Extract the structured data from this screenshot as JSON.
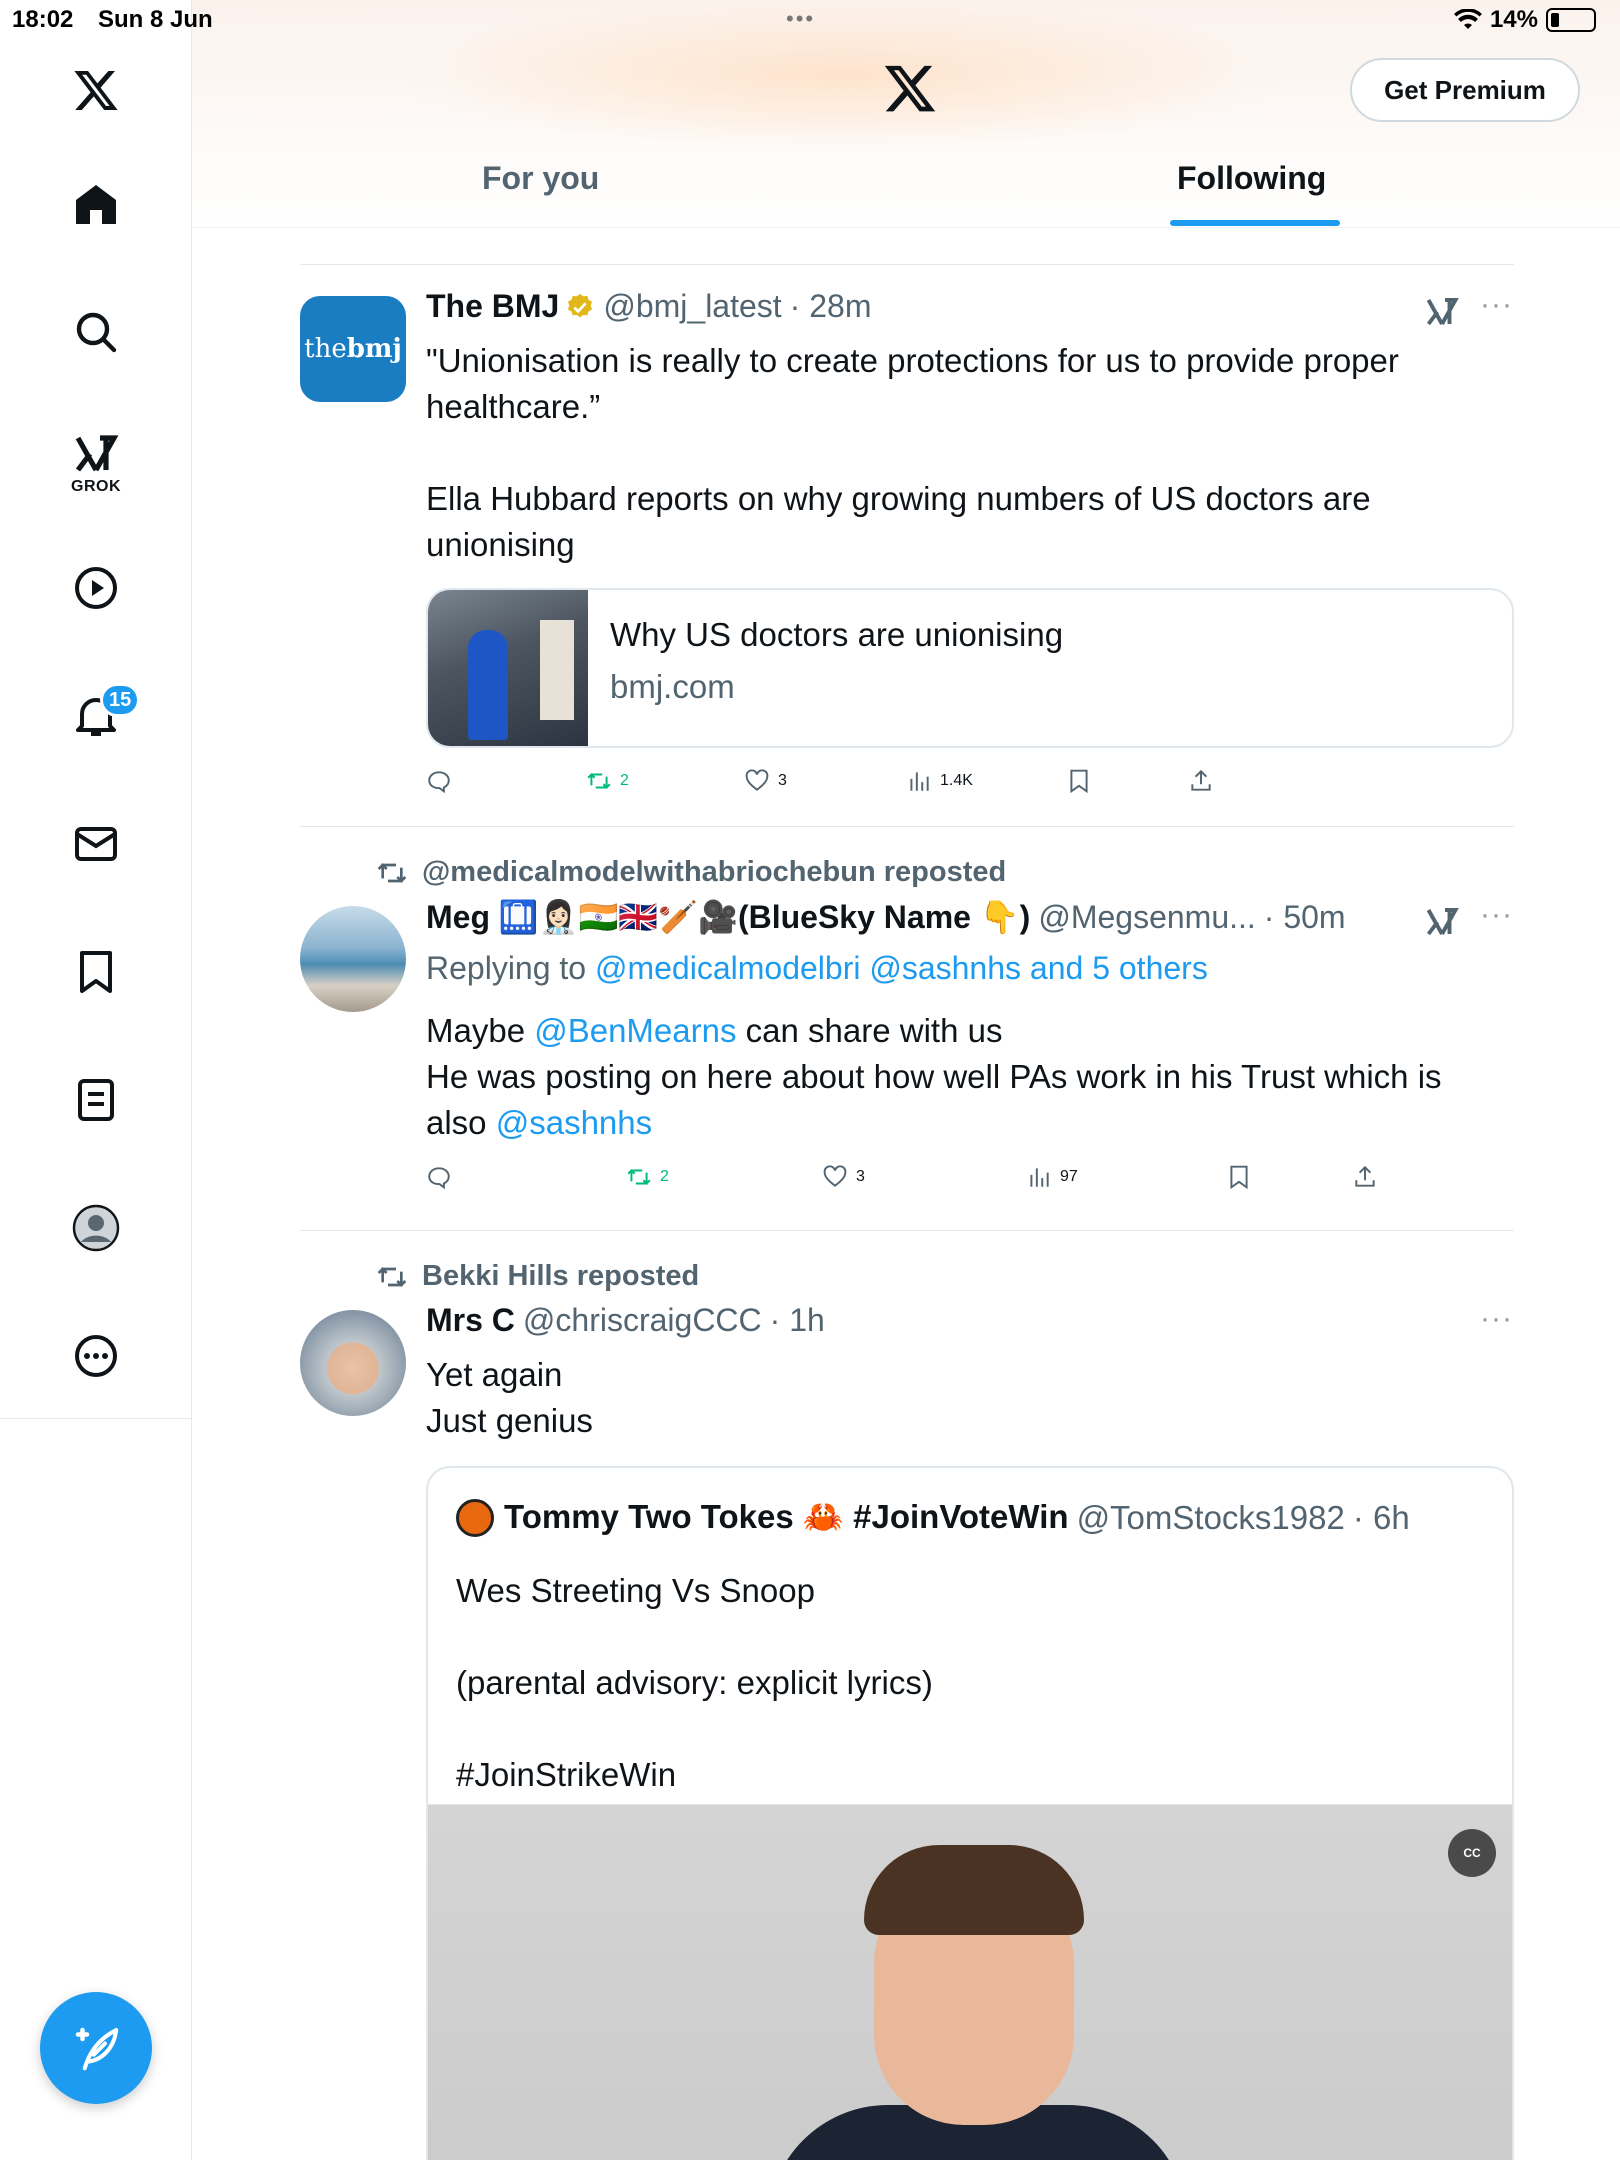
{
  "status_bar": {
    "time": "18:02",
    "date": "Sun 8 Jun",
    "battery": "14%"
  },
  "sidebar": {
    "grok_label": "GROK",
    "notifications_badge": "15",
    "icons": [
      "x-logo-icon",
      "home-icon",
      "search-icon",
      "grok-icon",
      "video-icon",
      "notifications-icon",
      "messages-icon",
      "bookmarks-icon",
      "lists-icon",
      "profile-icon",
      "more-icon",
      "compose-icon"
    ]
  },
  "header": {
    "premium_label": "Get Premium",
    "tabs": [
      {
        "label": "For you",
        "active": false
      },
      {
        "label": "Following",
        "active": true
      }
    ]
  },
  "colors": {
    "accent": "#1d9bf0",
    "repost_green": "#00ba7c",
    "secondary_text": "#536471"
  },
  "posts": [
    {
      "name": "The BMJ",
      "handle": "@bmj_latest",
      "time": "· 28m",
      "avatar_text_light": "the",
      "avatar_text_bold": "bmj",
      "text": "\"Unionisation is really to create protections for us to provide proper healthcare.”\n\nElla Hubbard reports on why growing numbers of US doctors are unionising",
      "card": {
        "title": "Why US doctors are unionising",
        "domain": "bmj.com"
      },
      "stats": {
        "reposts": "2",
        "likes": "3",
        "views": "1.4K"
      }
    },
    {
      "reposted_by": "@medicalmodelwithabriochebun reposted",
      "name": "Meg 🛄👩🏻‍⚕️🇮🇳🇬🇧🏏🎥(BlueSky Name 👇)",
      "handle": "@Megsenmu...",
      "time": "· 50m",
      "replying_prefix": "Replying to",
      "replying_to": "@medicalmodelbri @sashnhs and 5 others",
      "text_1": "Maybe ",
      "mention_1": "@BenMearns",
      "text_2": " can share with us\nHe was posting on here about how well PAs work in his Trust which is also ",
      "mention_2": "@sashnhs",
      "stats": {
        "reposts": "2",
        "likes": "3",
        "views": "97"
      }
    },
    {
      "reposted_by": "Bekki Hills reposted",
      "name": "Mrs C",
      "handle": "@chriscraigCCC",
      "time": "· 1h",
      "text": "Yet again\nJust genius",
      "quote": {
        "name": "Tommy Two Tokes 🦀 #JoinVoteWin",
        "handle": "@TomStocks1982",
        "time": "· 6h",
        "text": "Wes Streeting Vs Snoop\n\n(parental advisory: explicit lyrics)\n\n#JoinStrikeWin",
        "cc_label": "CC"
      }
    }
  ]
}
